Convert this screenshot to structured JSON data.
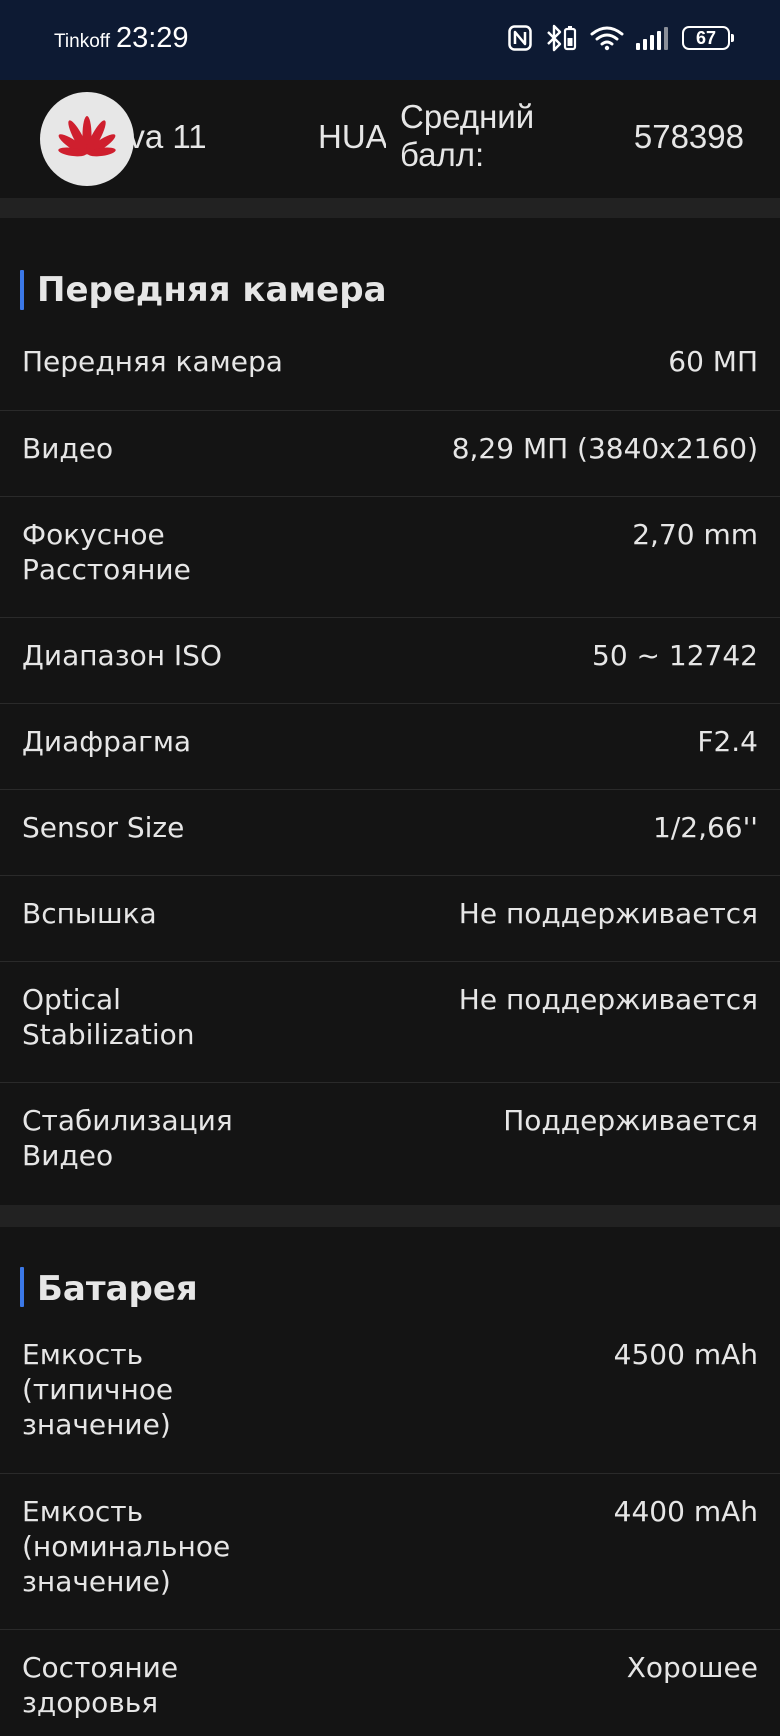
{
  "status_bar": {
    "carrier": "Tinkoff",
    "time": "23:29",
    "battery_level": "67",
    "icons": [
      "nfc-icon",
      "bluetooth-icon",
      "wifi-icon",
      "signal-icon",
      "battery-icon"
    ]
  },
  "device": {
    "logo": "huawei-logo",
    "model": "ova 11",
    "brand": "HUA",
    "score_label": "Средний балл:",
    "score_value": "578398"
  },
  "sections": [
    {
      "title": "Передняя камера",
      "rows": [
        {
          "label": "Передняя камера",
          "value": "60 МП"
        },
        {
          "label": "Видео",
          "value": "8,29 МП (3840x2160)"
        },
        {
          "label": "Фокусное Расстояние",
          "value": "2,70 mm"
        },
        {
          "label": "Диапазон ISO",
          "value": "50 ~ 12742"
        },
        {
          "label": "Диафрагма",
          "value": "F2.4"
        },
        {
          "label": "Sensor Size",
          "value": "1/2,66''"
        },
        {
          "label": "Вспышка",
          "value": "Не поддерживается"
        },
        {
          "label": "Optical Stabilization",
          "value": "Не поддерживается"
        },
        {
          "label": "Стабилизация Видео",
          "value": "Поддерживается"
        }
      ]
    },
    {
      "title": "Батарея",
      "rows": [
        {
          "label": "Емкость (типичное значение)",
          "value": "4500 mAh"
        },
        {
          "label": "Емкость (номинальное значение)",
          "value": "4400 mAh"
        },
        {
          "label": "Состояние здоровья",
          "value": "Хорошее"
        }
      ]
    }
  ],
  "colors": {
    "status_bar_bg": "#0d1a33",
    "page_bg": "#141414",
    "band_bg": "#222222",
    "accent": "#3b78e7",
    "logo_red": "#cf1f2e"
  }
}
